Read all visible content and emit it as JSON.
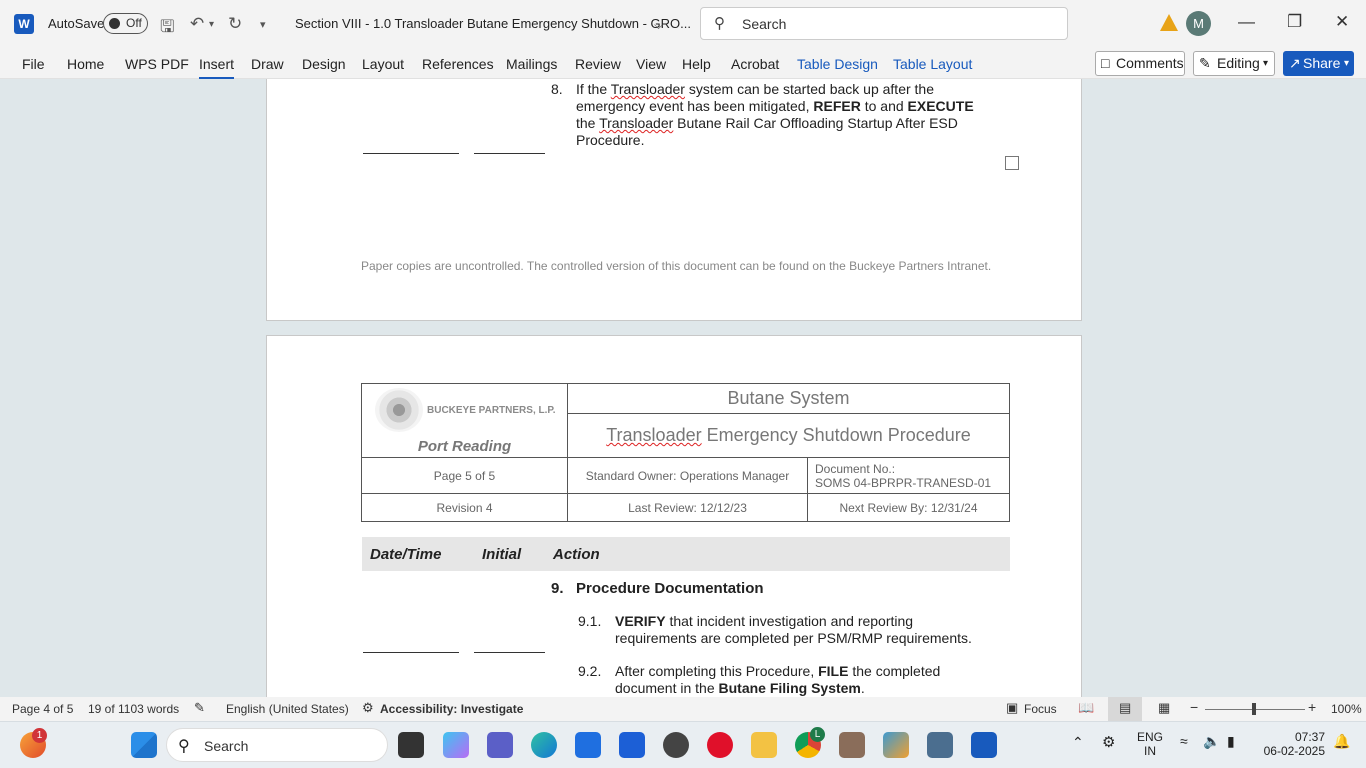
{
  "titlebar": {
    "autosave_label": "AutoSave",
    "autosave_state": "Off",
    "doc_title": "Section VIII - 1.0  Transloader Butane Emergency Shutdown - GRO...",
    "search_placeholder": "Search",
    "avatar_initial": "M"
  },
  "ribbon": {
    "tabs": [
      "File",
      "Home",
      "WPS PDF",
      "Insert",
      "Draw",
      "Design",
      "Layout",
      "References",
      "Mailings",
      "Review",
      "View",
      "Help",
      "Acrobat",
      "Table Design",
      "Table Layout"
    ],
    "active_tab": "Insert",
    "comments_label": "Comments",
    "editing_label": "Editing",
    "share_label": "Share"
  },
  "page4": {
    "item_num": "8.",
    "item_text_1": "If the ",
    "item_squig": "Transloader",
    "item_text_2": " system can be started back up after the emergency event has been mitigated, ",
    "refer": "REFER",
    "item_text_3": " to and ",
    "execute": "EXECUTE",
    "item_text_4": " the ",
    "item_squig2": "Transloader",
    "item_text_5": " Butane Rail Car Offloading Startup After ESD Procedure.",
    "footer_note": "Paper copies are uncontrolled. The controlled version of this document can be found on the Buckeye Partners Intranet."
  },
  "page5": {
    "logo_text": "BUCKEYE PARTNERS, L.P.",
    "location": "Port Reading",
    "system_title": "Butane System",
    "proc_title_squig": "Transloader",
    "proc_title_rest": " Emergency Shutdown Procedure",
    "page_of": "Page 5 of 5",
    "owner": "Standard Owner: Operations Manager",
    "docno_label": "Document No.:",
    "docno_value": "SOMS 04-BPRPR-TRANESD-01",
    "revision": "Revision 4",
    "last_review": "Last Review: 12/12/23",
    "next_review": "Next Review By: 12/31/24",
    "col_datetime": "Date/Time",
    "col_initial": "Initial",
    "col_action": "Action",
    "sec9_num": "9.",
    "sec9_title": "Procedure Documentation",
    "s91_num": "9.1.",
    "s91_bold": "VERIFY",
    "s91_text": " that incident investigation and reporting requirements are completed per PSM/RMP requirements.",
    "s92_num": "9.2.",
    "s92_text1": "After completing this Procedure, ",
    "s92_bold1": "FILE",
    "s92_text2": " the completed document in the ",
    "s92_bold2": "Butane Filing System",
    "s92_text3": "."
  },
  "statusbar": {
    "page": "Page 4 of 5",
    "words": "19 of 1103 words",
    "language": "English (United States)",
    "accessibility": "Accessibility: Investigate",
    "focus": "Focus",
    "zoom": "100%"
  },
  "taskbar": {
    "search_label": "Search",
    "notif_count": "1",
    "edge_badge": "L",
    "lang_line1": "ENG",
    "lang_line2": "IN",
    "time": "07:37",
    "date": "06-02-2025"
  },
  "colors": {
    "accent": "#185abd",
    "warning": "#e8a317"
  }
}
